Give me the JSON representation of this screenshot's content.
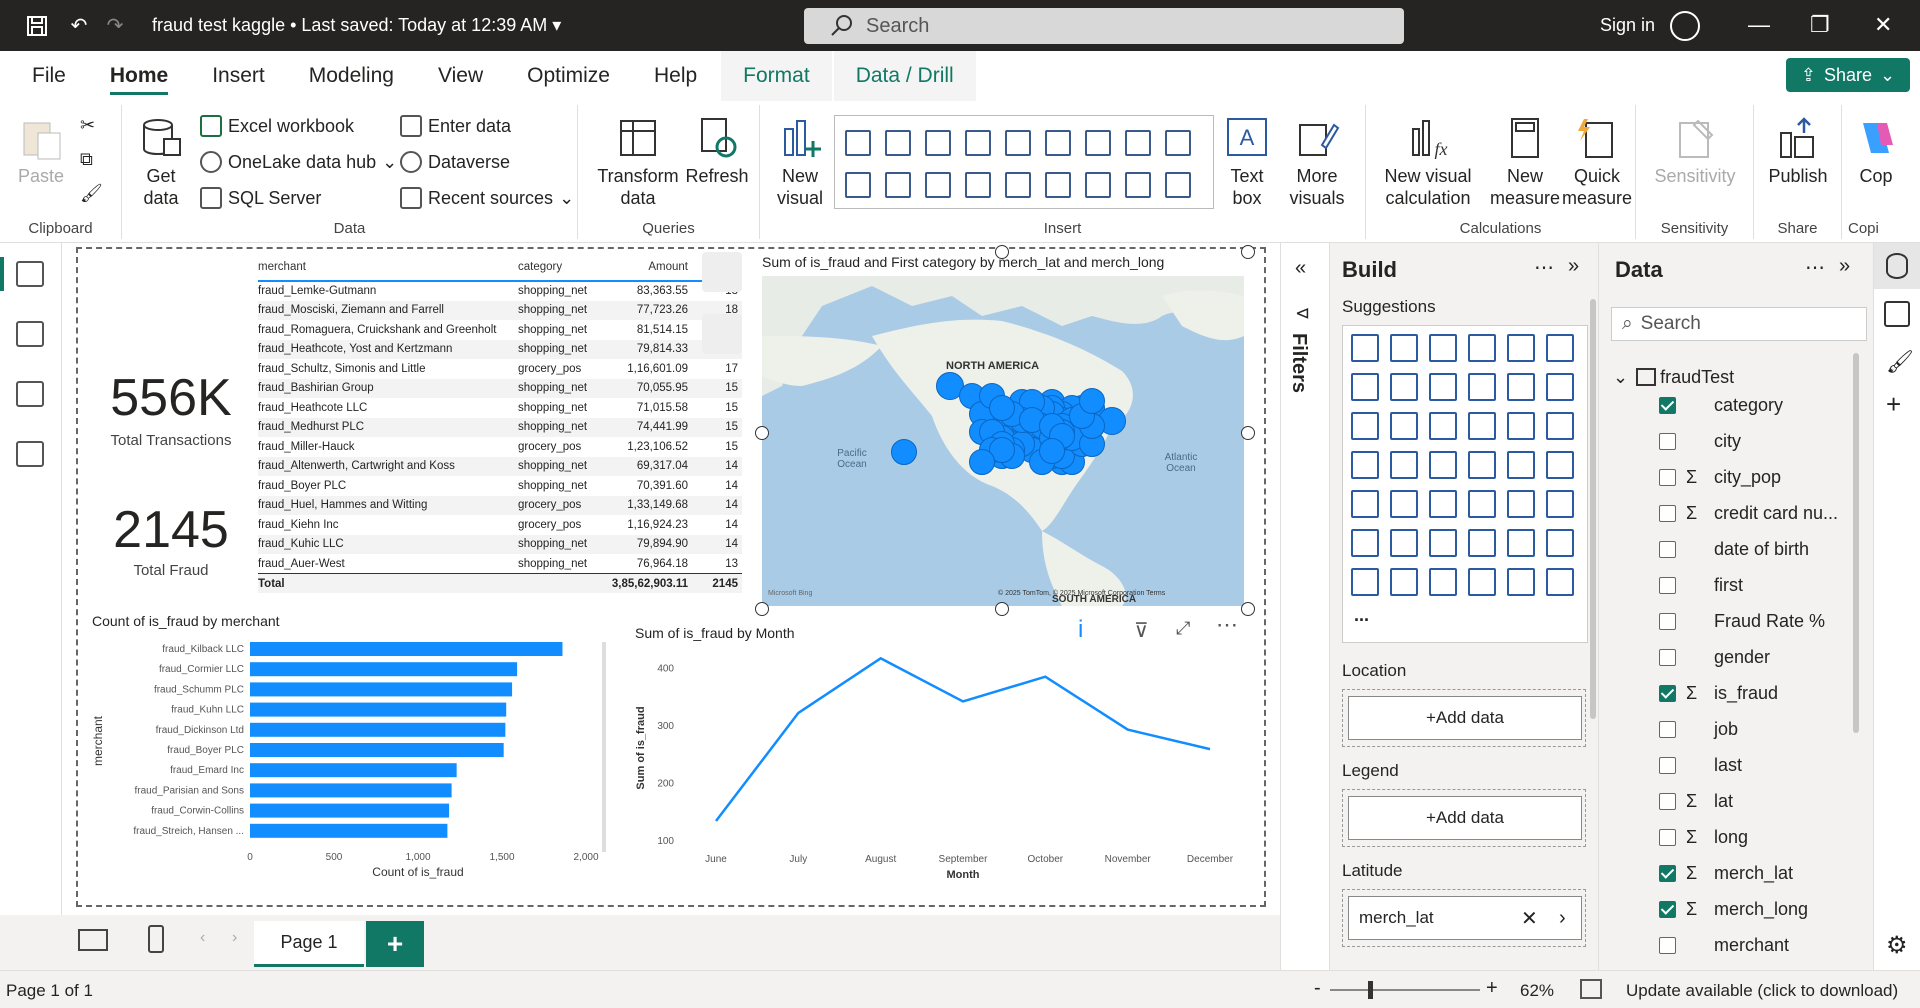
{
  "titlebar": {
    "doc_title": "fraud test kaggle",
    "saved": "Last saved: Today at 12:39 AM",
    "search_placeholder": "Search",
    "signin": "Sign in"
  },
  "menu": {
    "items": [
      "File",
      "Home",
      "Insert",
      "Modeling",
      "View",
      "Optimize",
      "Help"
    ],
    "context": [
      "Format",
      "Data / Drill"
    ],
    "share": "Share"
  },
  "ribbon": {
    "clipboard": {
      "paste": "Paste",
      "label": "Clipboard"
    },
    "data": {
      "get_data": "Get data",
      "excel": "Excel workbook",
      "onelake": "OneLake data hub",
      "sql": "SQL Server",
      "enter": "Enter data",
      "dataverse": "Dataverse",
      "recent": "Recent sources",
      "label": "Data"
    },
    "queries": {
      "transform": "Transform data",
      "refresh": "Refresh",
      "label": "Queries"
    },
    "insert": {
      "new_visual": "New visual",
      "text_box": "Text box",
      "more_visuals": "More visuals",
      "label": "Insert"
    },
    "calculations": {
      "new_visual_calc": "New visual calculation",
      "new_measure": "New measure",
      "quick_measure": "Quick measure",
      "label": "Calculations"
    },
    "sensitivity": {
      "btn": "Sensitivity",
      "label": "Sensitivity"
    },
    "share": {
      "publish": "Publish",
      "label": "Share"
    },
    "copilot": {
      "btn": "Cop",
      "label": "Copi"
    }
  },
  "kpis": [
    {
      "value": "556K",
      "label": "Total Transactions"
    },
    {
      "value": "2145",
      "label": "Total Fraud"
    }
  ],
  "merchant_table": {
    "headers": [
      "merchant",
      "category",
      "Amount",
      ""
    ],
    "rows": [
      [
        "fraud_Lemke-Gutmann",
        "shopping_net",
        "83,363.55",
        "18"
      ],
      [
        "fraud_Mosciski, Ziemann and Farrell",
        "shopping_net",
        "77,723.26",
        "18"
      ],
      [
        "fraud_Romaguera, Cruickshank and Greenholt",
        "shopping_net",
        "81,514.15",
        "17"
      ],
      [
        "fraud_Heathcote, Yost and Kertzmann",
        "shopping_net",
        "79,814.33",
        "17"
      ],
      [
        "fraud_Schultz, Simonis and Little",
        "grocery_pos",
        "1,16,601.09",
        "17"
      ],
      [
        "fraud_Bashirian Group",
        "shopping_net",
        "70,055.95",
        "15"
      ],
      [
        "fraud_Heathcote LLC",
        "shopping_net",
        "71,015.58",
        "15"
      ],
      [
        "fraud_Medhurst PLC",
        "shopping_net",
        "74,441.99",
        "15"
      ],
      [
        "fraud_Miller-Hauck",
        "grocery_pos",
        "1,23,106.52",
        "15"
      ],
      [
        "fraud_Altenwerth, Cartwright and Koss",
        "shopping_net",
        "69,317.04",
        "14"
      ],
      [
        "fraud_Boyer PLC",
        "shopping_net",
        "70,391.60",
        "14"
      ],
      [
        "fraud_Huel, Hammes and Witting",
        "grocery_pos",
        "1,33,149.68",
        "14"
      ],
      [
        "fraud_Kiehn Inc",
        "grocery_pos",
        "1,16,924.23",
        "14"
      ],
      [
        "fraud_Kuhic LLC",
        "shopping_net",
        "79,894.90",
        "14"
      ],
      [
        "fraud_Auer-West",
        "shopping_net",
        "76,964.18",
        "13"
      ]
    ],
    "total": [
      "Total",
      "",
      "3,85,62,903.11",
      "2145"
    ]
  },
  "map": {
    "title": "Sum of is_fraud and First category by merch_lat and merch_long",
    "labels": {
      "na": "NORTH AMERICA",
      "pacific": "Pacific Ocean",
      "atlantic": "Atlantic Ocean",
      "sa": "SOUTH AMERICA"
    },
    "attribution": "© 2025 TomTom, © 2025 Microsoft Corporation Terms",
    "bing": "Microsoft Bing",
    "dot_color": "#118DFF"
  },
  "chart_data": [
    {
      "type": "bar",
      "title": "Count of is_fraud by merchant",
      "xlabel": "Count of is_fraud",
      "ylabel": "merchant",
      "categories": [
        "fraud_Kilback LLC",
        "fraud_Cormier LLC",
        "fraud_Schumm PLC",
        "fraud_Kuhn LLC",
        "fraud_Dickinson Ltd",
        "fraud_Boyer PLC",
        "fraud_Emard Inc",
        "fraud_Parisian and Sons",
        "fraud_Corwin-Collins",
        "fraud_Streich, Hansen ..."
      ],
      "values": [
        1860,
        1590,
        1560,
        1525,
        1520,
        1510,
        1230,
        1200,
        1185,
        1175
      ],
      "xlim": [
        0,
        2000
      ],
      "xticks": [
        "0",
        "500",
        "1,000",
        "1,500",
        "2,000"
      ],
      "color": "#118DFF"
    },
    {
      "type": "line",
      "title": "Sum of is_fraud by Month",
      "xlabel": "Month",
      "ylabel": "Sum of is_fraud",
      "categories": [
        "June",
        "July",
        "August",
        "September",
        "October",
        "November",
        "December"
      ],
      "values": [
        133,
        321,
        416,
        341,
        384,
        292,
        258
      ],
      "ylim": [
        100,
        420
      ],
      "yticks": [
        "100",
        "200",
        "300",
        "400"
      ],
      "color": "#118DFF"
    }
  ],
  "filters": {
    "label": "Filters"
  },
  "build": {
    "title": "Build",
    "suggestions": "Suggestions",
    "more": "...",
    "wells": [
      {
        "label": "Location",
        "btn": "+Add data"
      },
      {
        "label": "Legend",
        "btn": "+Add data"
      },
      {
        "label": "Latitude",
        "value": "merch_lat"
      }
    ]
  },
  "data_pane": {
    "title": "Data",
    "search_placeholder": "Search",
    "table": "fraudTest",
    "fields": [
      {
        "name": "category",
        "checked": true,
        "sigma": false
      },
      {
        "name": "city",
        "checked": false,
        "sigma": false
      },
      {
        "name": "city_pop",
        "checked": false,
        "sigma": true
      },
      {
        "name": "credit card nu...",
        "checked": false,
        "sigma": true
      },
      {
        "name": "date of birth",
        "checked": false,
        "sigma": false
      },
      {
        "name": "first",
        "checked": false,
        "sigma": false
      },
      {
        "name": "Fraud Rate %",
        "checked": false,
        "sigma": false
      },
      {
        "name": "gender",
        "checked": false,
        "sigma": false
      },
      {
        "name": "is_fraud",
        "checked": true,
        "sigma": true
      },
      {
        "name": "job",
        "checked": false,
        "sigma": false
      },
      {
        "name": "last",
        "checked": false,
        "sigma": false
      },
      {
        "name": "lat",
        "checked": false,
        "sigma": true
      },
      {
        "name": "long",
        "checked": false,
        "sigma": true
      },
      {
        "name": "merch_lat",
        "checked": true,
        "sigma": true
      },
      {
        "name": "merch_long",
        "checked": true,
        "sigma": true
      },
      {
        "name": "merchant",
        "checked": false,
        "sigma": false
      }
    ]
  },
  "pages": {
    "tab": "Page 1",
    "add": "+"
  },
  "status": {
    "page": "Page 1 of 1",
    "zoom": "62%",
    "update": "Update available (click to download)"
  }
}
